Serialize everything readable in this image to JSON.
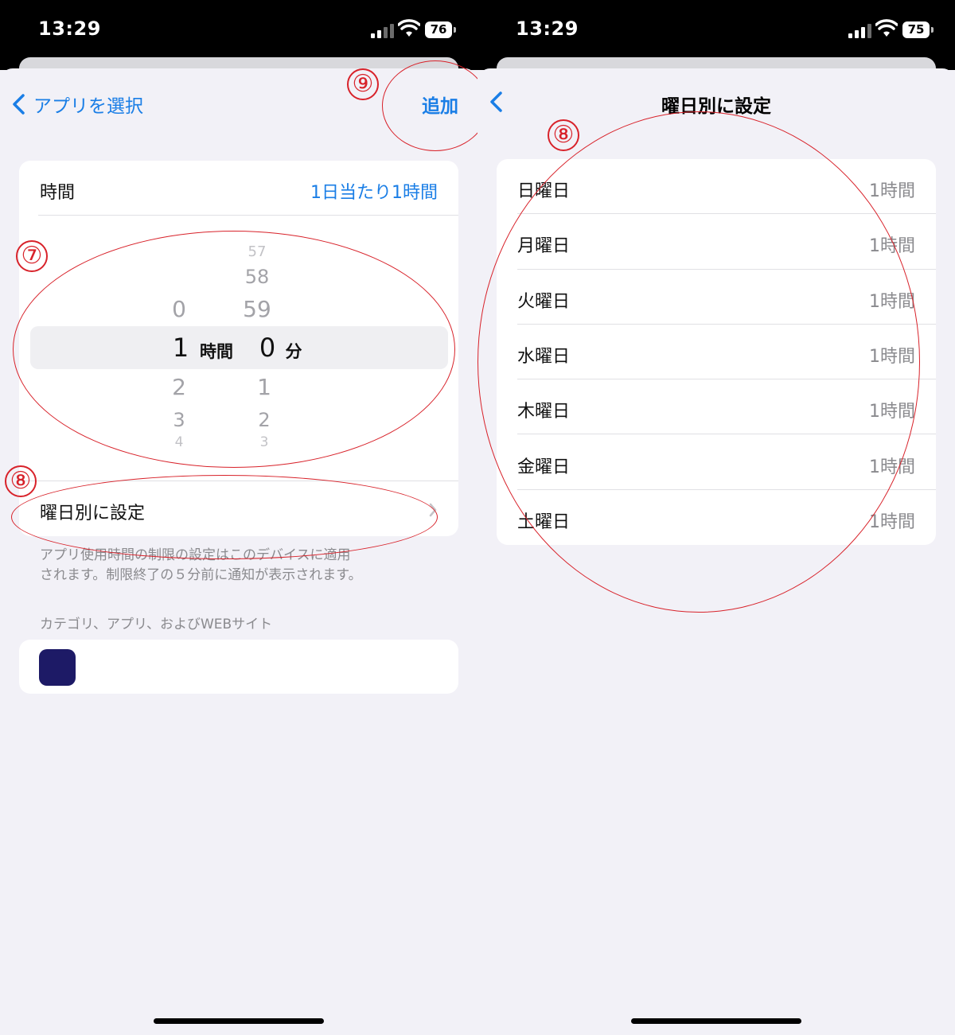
{
  "left": {
    "status": {
      "time": "13:29",
      "battery": "76"
    },
    "nav": {
      "back_label": "アプリを選択",
      "action_label": "追加"
    },
    "time_row": {
      "label": "時間",
      "value": "1日当たり1時間"
    },
    "picker": {
      "hours_above": [
        "0"
      ],
      "hour_selected": "1",
      "hour_unit": "時間",
      "hours_below": [
        "2",
        "3",
        "4"
      ],
      "minutes_above": [
        "57",
        "58",
        "59"
      ],
      "minute_selected": "0",
      "minute_unit": "分",
      "minutes_below": [
        "1",
        "2",
        "3"
      ]
    },
    "weekday_row": {
      "label": "曜日別に設定"
    },
    "footnote_line1": "アプリ使用時間の制限の設定はこのデバイスに適用",
    "footnote_line2": "されます。制限終了の５分前に通知が表示されます。",
    "section_header": "カテゴリ、アプリ、およびWEBサイト",
    "app_icon_color": "#1d1a66"
  },
  "right": {
    "status": {
      "time": "13:29",
      "battery": "75"
    },
    "nav": {
      "title": "曜日別に設定"
    },
    "days": [
      {
        "label": "日曜日",
        "value": "1時間"
      },
      {
        "label": "月曜日",
        "value": "1時間"
      },
      {
        "label": "火曜日",
        "value": "1時間"
      },
      {
        "label": "水曜日",
        "value": "1時間"
      },
      {
        "label": "木曜日",
        "value": "1時間"
      },
      {
        "label": "金曜日",
        "value": "1時間"
      },
      {
        "label": "土曜日",
        "value": "1時間"
      }
    ]
  },
  "annotations": {
    "mark7": "⑦",
    "mark8_left": "⑧",
    "mark9": "⑨",
    "mark8_right": "⑧"
  },
  "colors": {
    "accent": "#1a7ee6",
    "annotation": "#d8222a",
    "background": "#f2f1f7"
  }
}
